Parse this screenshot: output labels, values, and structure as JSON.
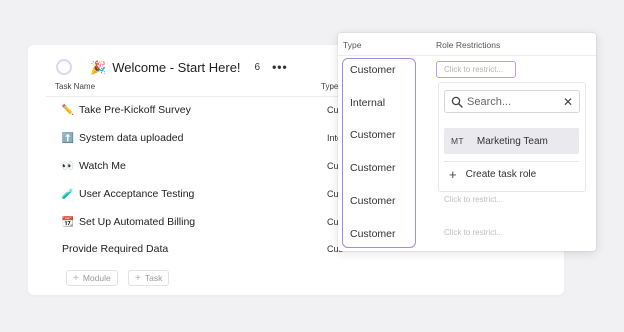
{
  "header": {
    "title": "Welcome - Start Here!",
    "count": "6",
    "more_label": "•••"
  },
  "columns": {
    "task_name": "Task Name",
    "type_cut": "Type"
  },
  "tasks": [
    {
      "icon": "pencil-icon",
      "glyph": "✏️",
      "name": "Take Pre-Kickoff Survey",
      "type_cut": "Cus"
    },
    {
      "icon": "up-arrow-icon",
      "glyph": "⬆️",
      "name": "System data uploaded",
      "type_cut": "Inte"
    },
    {
      "icon": "eyes-icon",
      "glyph": "👀",
      "name": "Watch Me",
      "type_cut": "Cus"
    },
    {
      "icon": "test-tube-icon",
      "glyph": "🧪",
      "name": "User Acceptance Testing",
      "type_cut": "Cus"
    },
    {
      "icon": "calendar-icon",
      "glyph": "📆",
      "name": "Set Up Automated Billing",
      "type_cut": "Cus"
    },
    {
      "icon": "",
      "glyph": "",
      "name": "Provide Required Data",
      "type_cut": "Cus"
    }
  ],
  "footer": {
    "add_module": "Module",
    "add_task": "Task"
  },
  "panel": {
    "type_header": "Type",
    "restrictions_header": "Role Restrictions",
    "types": [
      "Customer",
      "Internal",
      "Customer",
      "Customer",
      "Customer",
      "Customer"
    ],
    "restrict_placeholder": "Click to restrict...",
    "search_placeholder": "Search...",
    "role_option": {
      "abbr": "MT",
      "name": "Marketing Team"
    },
    "create_role": "Create task role"
  },
  "colors": {
    "accent": "#a48be0",
    "background": "#f1f1f4"
  }
}
